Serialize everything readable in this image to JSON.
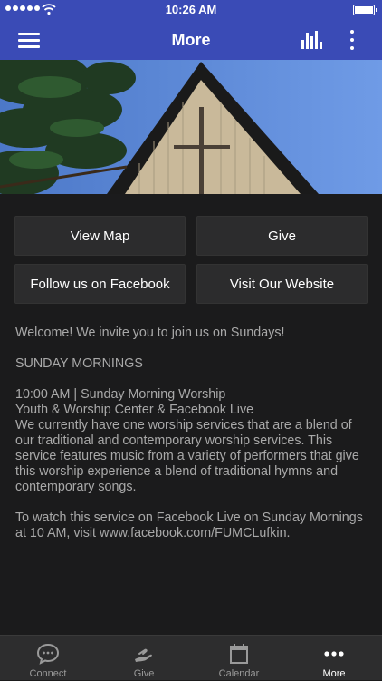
{
  "status_bar": {
    "time": "10:26 AM"
  },
  "nav": {
    "title": "More"
  },
  "buttons": {
    "view_map": "View Map",
    "give": "Give",
    "facebook": "Follow us on Facebook",
    "website": "Visit Our Website"
  },
  "content": {
    "welcome": "Welcome! We invite you to join us on Sundays!",
    "heading": "SUNDAY MORNINGS",
    "service_time": "10:00 AM  | Sunday Morning Worship",
    "service_location": "Youth & Worship Center & Facebook Live",
    "description": "We currently have one worship services that are a blend of our traditional and contemporary worship services. This service features music from a variety of performers that give this worship experience a blend of traditional hymns and contemporary songs.",
    "facebook_note": "To watch this service on Facebook Live on Sunday Mornings at 10 AM, visit www.facebook.com/FUMCLufkin."
  },
  "tabs": [
    {
      "label": "Connect",
      "icon": "chat-bubble-icon"
    },
    {
      "label": "Give",
      "icon": "giving-hand-icon"
    },
    {
      "label": "Calendar",
      "icon": "calendar-icon"
    },
    {
      "label": "More",
      "icon": "more-dots-icon"
    }
  ],
  "colors": {
    "header": "#3a4bb6",
    "background": "#1b1b1c",
    "button": "#2c2c2d"
  }
}
